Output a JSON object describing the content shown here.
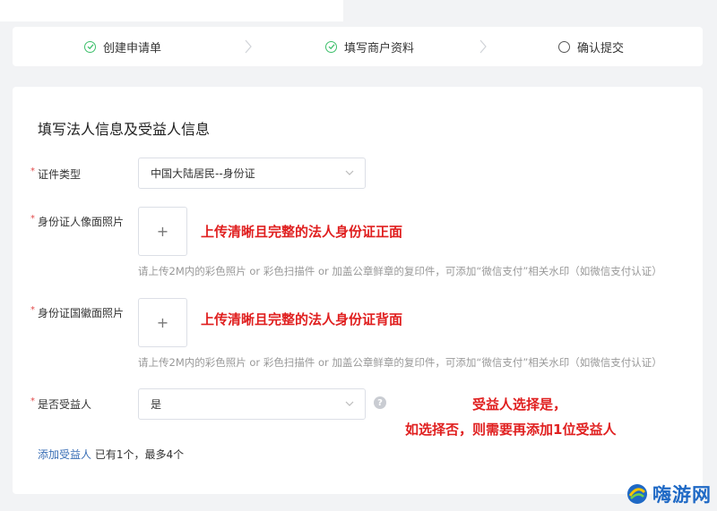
{
  "steps": [
    {
      "label": "创建申请单",
      "status": "done"
    },
    {
      "label": "填写商户资料",
      "status": "done"
    },
    {
      "label": "确认提交",
      "status": "todo"
    }
  ],
  "form": {
    "title": "填写法人信息及受益人信息",
    "id_type": {
      "label": "证件类型",
      "value": "中国大陆居民--身份证"
    },
    "id_front": {
      "label": "身份证人像面照片",
      "plus": "+",
      "annotation": "上传清晰且完整的法人身份证正面",
      "hint": "请上传2M内的彩色照片 or 彩色扫描件 or 加盖公章鲜章的复印件，可添加“微信支付”相关水印（如微信支付认证）"
    },
    "id_back": {
      "label": "身份证国徽面照片",
      "plus": "+",
      "annotation": "上传清晰且完整的法人身份证背面",
      "hint": "请上传2M内的彩色照片 or 彩色扫描件 or 加盖公章鲜章的复印件，可添加“微信支付”相关水印（如微信支付认证）"
    },
    "beneficiary": {
      "label": "是否受益人",
      "value": "是",
      "help": "?",
      "annotation_line1": "受益人选择是，",
      "annotation_line2": "如选择否，则需要再添加1位受益人"
    },
    "add_beneficiary": {
      "link": "添加受益人",
      "info": "已有1个，最多4个"
    }
  },
  "watermark": {
    "text": "嗨游网"
  },
  "colors": {
    "done": "#3cbf6a",
    "annotation": "#e02020",
    "link": "#3b6fb6",
    "watermark": "#1f69c5"
  }
}
